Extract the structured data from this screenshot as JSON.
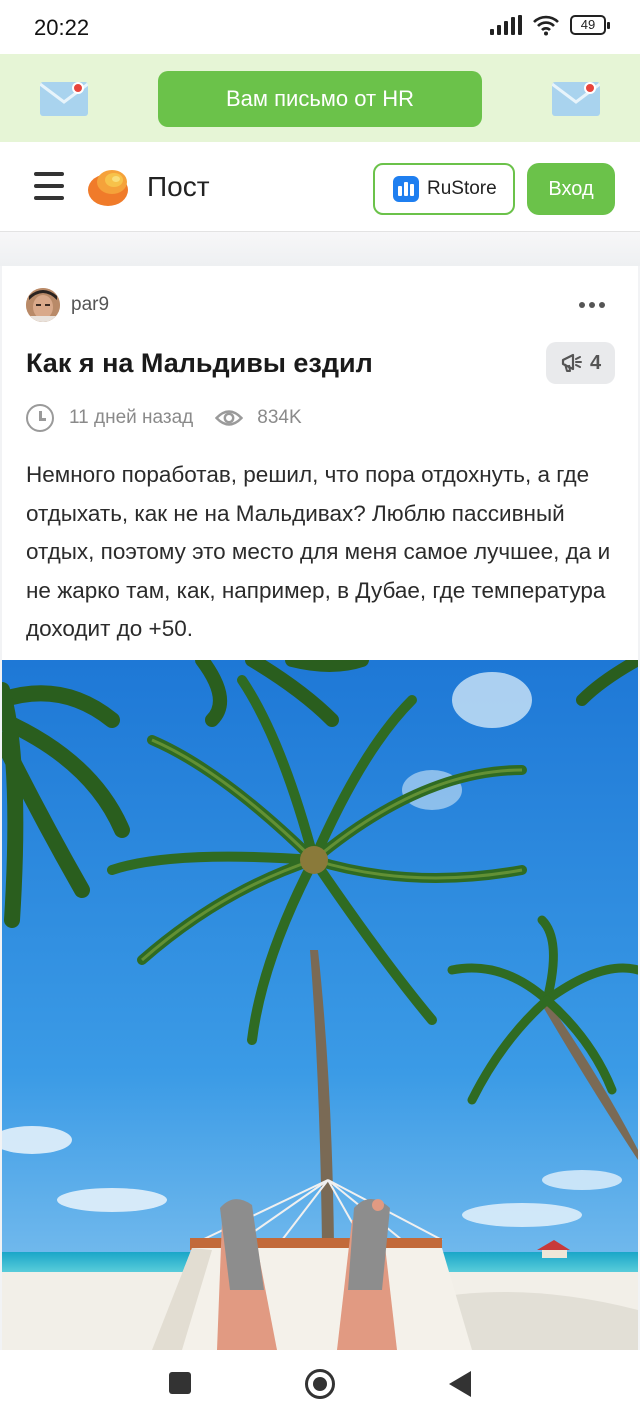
{
  "status_bar": {
    "time": "20:22",
    "battery": "49"
  },
  "promo": {
    "button_label": "Вам письмо от HR"
  },
  "header": {
    "brand": "Пост",
    "rustore_label": "RuStore",
    "login_label": "Вход"
  },
  "post": {
    "author": "par9",
    "title": "Как я на Мальдивы ездил",
    "comments_count": "4",
    "time_ago": "11 дней назад",
    "views": "834K",
    "text": "Немного поработав, решил, что пора отдохнуть, а где отдыхать, как не на Мальдивах? Люблю пассивный отдых, поэтому это место для меня самое лучшее, да и не жарко там, как, например, в Дубае, где температура доходит до +50."
  },
  "colors": {
    "accent_green": "#6bc24a",
    "promo_bg": "#e6f5d6",
    "rustore_blue": "#1f7ff0"
  }
}
